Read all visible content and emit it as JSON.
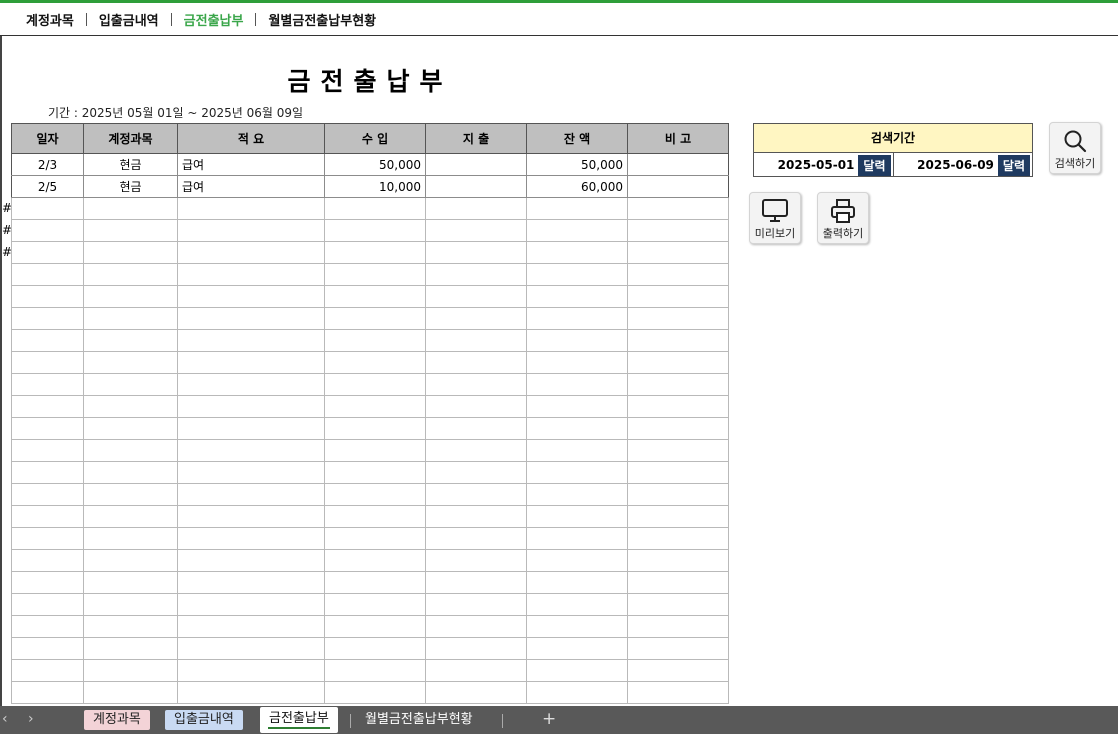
{
  "topnav": [
    "계정과목",
    "입출금내역",
    "금전출납부",
    "월별금전출납부현황"
  ],
  "title": "금전출납부",
  "period_text": "기간 :  2025년 05월 01일 ~ 2025년 06월 09일",
  "hash_marks": [
    "#",
    "#",
    "#"
  ],
  "table": {
    "columns": [
      "일자",
      "계정과목",
      "적 요",
      "수 입",
      "지 출",
      "잔 액",
      "비 고"
    ],
    "rows": [
      {
        "date": "2/3",
        "account": "현금",
        "memo": "급여",
        "income": "50,000",
        "expense": "",
        "balance": "50,000",
        "note": ""
      },
      {
        "date": "2/5",
        "account": "현금",
        "memo": "급여",
        "income": "10,000",
        "expense": "",
        "balance": "60,000",
        "note": ""
      }
    ],
    "empty_rows": 23
  },
  "search": {
    "title": "검색기간",
    "start": "2025-05-01",
    "end": "2025-06-09",
    "calendar_label": "달력"
  },
  "buttons": {
    "search": "검색하기",
    "preview": "미리보기",
    "print": "출력하기"
  },
  "sheet_tabs": [
    "계정과목",
    "입출금내역",
    "금전출납부",
    "월별금전출납부현황"
  ],
  "arrows": {
    "prev": "‹",
    "next": "›"
  },
  "add_tab": "+",
  "colors": {
    "accent_green": "#3aa64a",
    "header_gray": "#bfbfbf",
    "search_header": "#fff6c2",
    "calendar_btn": "#1f3a60"
  }
}
